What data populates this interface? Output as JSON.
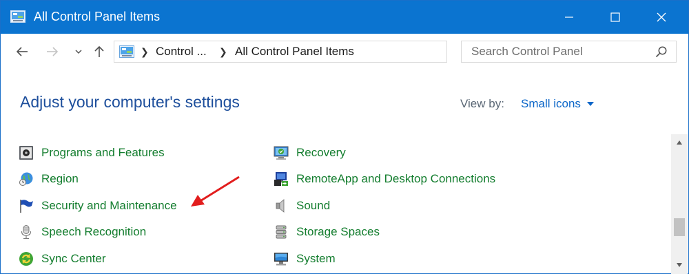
{
  "window": {
    "title": "All Control Panel Items",
    "icon": "control-panel-icon",
    "controls": [
      "minimize",
      "maximize",
      "close"
    ]
  },
  "nav": {
    "back_icon": "back-arrow-icon",
    "forward_icon": "forward-arrow-icon",
    "recent_icon": "chevron-down-icon",
    "up_icon": "up-arrow-icon",
    "breadcrumb": [
      "Control ...",
      "All Control Panel Items"
    ],
    "refresh_icon": "refresh-icon",
    "search_placeholder": "Search Control Panel",
    "search_value": ""
  },
  "main": {
    "heading": "Adjust your computer's settings",
    "view_by_label": "View by:",
    "view_by_value": "Small icons",
    "column1": [
      {
        "label": "Programs and Features",
        "icon": "programs-features-icon"
      },
      {
        "label": "Region",
        "icon": "region-globe-icon"
      },
      {
        "label": "Security and Maintenance",
        "icon": "flag-icon"
      },
      {
        "label": "Speech Recognition",
        "icon": "microphone-icon"
      },
      {
        "label": "Sync Center",
        "icon": "sync-icon"
      }
    ],
    "column2": [
      {
        "label": "Recovery",
        "icon": "recovery-icon"
      },
      {
        "label": "RemoteApp and Desktop Connections",
        "icon": "remote-desktop-icon"
      },
      {
        "label": "Sound",
        "icon": "speaker-icon"
      },
      {
        "label": "Storage Spaces",
        "icon": "storage-icon"
      },
      {
        "label": "System",
        "icon": "computer-icon"
      }
    ]
  },
  "colors": {
    "titlebar": "#0b74d0",
    "heading": "#1e4f9c",
    "item_text": "#137d2e",
    "link": "#0b66c8",
    "annotation": "#e21d1d"
  }
}
